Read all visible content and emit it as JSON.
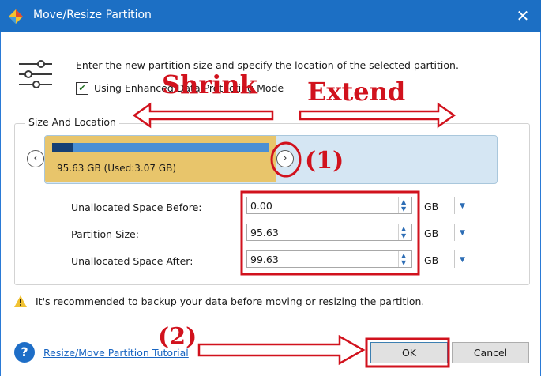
{
  "window": {
    "title": "Move/Resize Partition",
    "close_glyph": "✕",
    "icon": "minitool-partition-icon"
  },
  "header": {
    "instruction": "Enter the new partition size and specify the location of the selected partition.",
    "checkbox_label": "Using Enhanced Data Protecting Mode",
    "checkbox_checked": true
  },
  "size_location": {
    "group_title": "Size And Location",
    "partition_label": "95.63 GB (Used:3.07 GB)",
    "used_fraction": 0.032,
    "left_arrow": "‹",
    "right_arrow": "›",
    "fields": [
      {
        "label": "Unallocated Space Before:",
        "value": "0.00",
        "unit": "GB"
      },
      {
        "label": "Partition Size:",
        "value": "95.63",
        "unit": "GB"
      },
      {
        "label": "Unallocated Space After:",
        "value": "99.63",
        "unit": "GB"
      }
    ]
  },
  "warning": {
    "text": "It's recommended to backup your data before moving or resizing the partition."
  },
  "footer": {
    "help_glyph": "?",
    "tutorial_link": "Resize/Move Partition Tutorial",
    "ok_label": "OK",
    "cancel_label": "Cancel"
  },
  "annotations": {
    "shrink": "Shrink",
    "extend": "Extend",
    "step1": "(1)",
    "step2": "(2)",
    "color": "#d1121d"
  },
  "colors": {
    "titlebar": "#1c6fc4",
    "partition": "#e8c56b",
    "unallocated": "#d5e6f3",
    "used_bar": "#4a8fd4"
  }
}
